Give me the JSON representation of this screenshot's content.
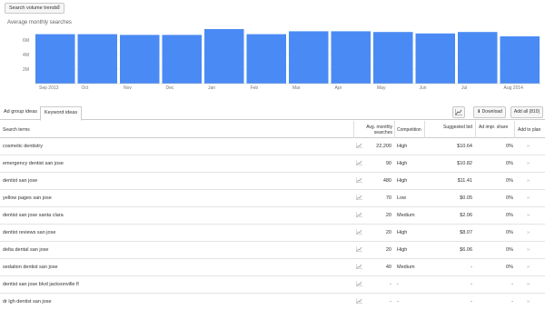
{
  "controls": {
    "view_select": "Search volume trends",
    "caret": "⇕"
  },
  "chart_data": {
    "type": "bar",
    "title": "Average monthly searches",
    "categories": [
      "Sep 2013",
      "Oct",
      "Nov",
      "Dec",
      "Jan",
      "Feb",
      "Mar",
      "Apr",
      "May",
      "Jun",
      "Jul",
      "Aug 2014"
    ],
    "values": [
      6800000,
      6800000,
      6700000,
      6700000,
      7500000,
      6800000,
      7200000,
      7200000,
      7100000,
      6900000,
      7100000,
      6500000
    ],
    "ytick_labels": [
      "6M",
      "4M",
      "2M"
    ],
    "ytick_values": [
      6000000,
      4000000,
      2000000
    ],
    "ylim": [
      0,
      8000000
    ],
    "grid": true,
    "color": "#4a8af4"
  },
  "tabs": [
    {
      "label": "Ad group ideas"
    },
    {
      "label": "Keyword ideas"
    }
  ],
  "toolbar": {
    "chart_icon": "chart-icon",
    "download_label": "Download",
    "add_all_label": "Add all (810)"
  },
  "table": {
    "headers": {
      "term": "Search terms",
      "avg": "Avg. monthly searches",
      "competition": "Competition",
      "bid": "Suggested bid",
      "share": "Ad impr. share",
      "add": "Add to plan"
    },
    "rows": [
      {
        "term": "cosmetic dentistry",
        "avg": "22,200",
        "competition": "High",
        "bid": "$10.64",
        "share": "0%"
      },
      {
        "term": "emergency dentist san jose",
        "avg": "90",
        "competition": "High",
        "bid": "$10.82",
        "share": "0%"
      },
      {
        "term": "dentist san jose",
        "avg": "480",
        "competition": "High",
        "bid": "$11.41",
        "share": "0%"
      },
      {
        "term": "yellow pages san jose",
        "avg": "70",
        "competition": "Low",
        "bid": "$0.05",
        "share": "0%"
      },
      {
        "term": "dentist san jose santa clara",
        "avg": "20",
        "competition": "Medium",
        "bid": "$2.06",
        "share": "0%"
      },
      {
        "term": "dentist reviews san jose",
        "avg": "20",
        "competition": "High",
        "bid": "$8.07",
        "share": "0%"
      },
      {
        "term": "delta dental san jose",
        "avg": "20",
        "competition": "High",
        "bid": "$6.06",
        "share": "0%"
      },
      {
        "term": "sedation dentist san jose",
        "avg": "40",
        "competition": "Medium",
        "bid": "-",
        "share": "0%"
      },
      {
        "term": "dentist san jose blvd jacksonville fl",
        "avg": "-",
        "competition": "-",
        "bid": "-",
        "share": "-"
      },
      {
        "term": "dr lgh dentist san jose",
        "avg": "-",
        "competition": "-",
        "bid": "-",
        "share": "-"
      }
    ],
    "trend_icon": "trend-icon",
    "add_icon": "»"
  }
}
